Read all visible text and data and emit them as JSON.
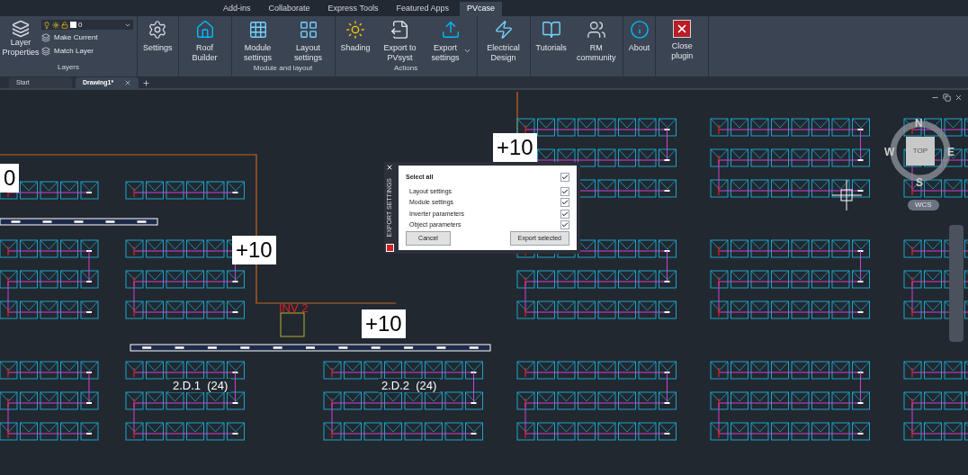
{
  "ribbon_tabs": [
    {
      "label": "Add-ins",
      "selected": false
    },
    {
      "label": "Collaborate",
      "selected": false
    },
    {
      "label": "Express Tools",
      "selected": false
    },
    {
      "label": "Featured Apps",
      "selected": false
    },
    {
      "label": "PVcase",
      "selected": true
    }
  ],
  "layers_panel": {
    "title": "Layers",
    "large_button": "Layer Properties",
    "layer_value": "0",
    "actions": [
      "Make Current",
      "Match Layer"
    ]
  },
  "panels": [
    {
      "buttons": [
        {
          "label": "Settings"
        }
      ]
    },
    {
      "buttons": [
        {
          "label": "Roof Builder"
        }
      ]
    },
    {
      "title": "Module and layout",
      "buttons": [
        {
          "label": "Module settings"
        },
        {
          "label": "Layout settings"
        }
      ]
    },
    {
      "title": "Actions",
      "buttons": [
        {
          "label": "Shading"
        },
        {
          "label": "Export to PVsyst"
        },
        {
          "label": "Export settings",
          "dropdown": true
        }
      ]
    },
    {
      "buttons": [
        {
          "label": "Electrical Design"
        }
      ]
    },
    {
      "buttons": [
        {
          "label": "Tutorials"
        },
        {
          "label": "RM community"
        }
      ]
    },
    {
      "buttons": [
        {
          "label": "About"
        }
      ]
    },
    {
      "buttons": [
        {
          "label": "Close plugin"
        }
      ]
    }
  ],
  "document_tabs": [
    {
      "label": "Start",
      "selected": false
    },
    {
      "label": "Drawing1*",
      "selected": true
    }
  ],
  "canvas_labels": [
    {
      "kind": "count",
      "text": "0"
    },
    {
      "kind": "count",
      "text": "+10"
    },
    {
      "kind": "count",
      "text": "+10"
    },
    {
      "kind": "count",
      "text": "+10"
    },
    {
      "kind": "inverter",
      "text": "INV 2"
    },
    {
      "kind": "string",
      "text": "2.D.1  (24)"
    },
    {
      "kind": "string",
      "text": "2.D.2  (24)"
    }
  ],
  "viewcube": {
    "north": "N",
    "west": "W",
    "east": "E",
    "south": "S",
    "top": "TOP",
    "wcs": "WCS"
  },
  "dialog": {
    "side_title": "EXPORT SETTINGS",
    "select_all": {
      "label": "Select all",
      "checked": true
    },
    "options": [
      {
        "label": "Layout settings",
        "checked": true
      },
      {
        "label": "Module settings",
        "checked": true
      },
      {
        "label": "Inverter parameters",
        "checked": true
      },
      {
        "label": "Object parameters",
        "checked": true
      }
    ],
    "buttons": [
      "Cancel",
      "Export selected"
    ]
  }
}
